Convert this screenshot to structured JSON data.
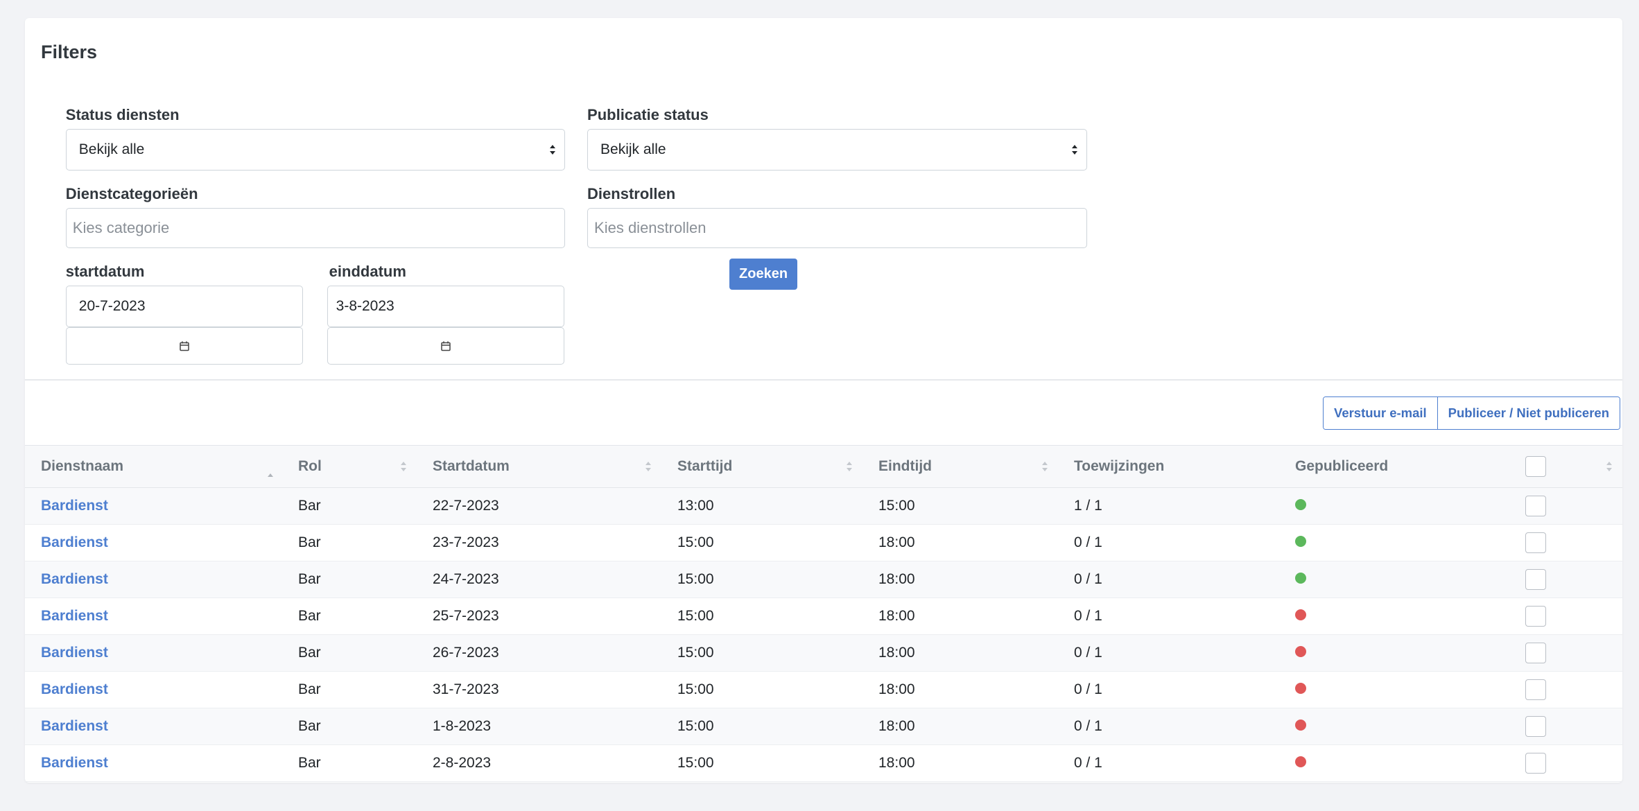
{
  "filters": {
    "title": "Filters",
    "status_diensten": {
      "label": "Status diensten",
      "value": "Bekijk alle"
    },
    "publicatie_status": {
      "label": "Publicatie status",
      "value": "Bekijk alle"
    },
    "dienstcategorieen": {
      "label": "Dienstcategorieën",
      "placeholder": "Kies categorie"
    },
    "dienstrollen": {
      "label": "Dienstrollen",
      "placeholder": "Kies dienstrollen"
    },
    "startdatum": {
      "label": "startdatum",
      "value": "20-7-2023"
    },
    "einddatum": {
      "label": "einddatum",
      "value": "3-8-2023"
    },
    "search_button": "Zoeken"
  },
  "actions": {
    "send_email": "Verstuur e-mail",
    "publish_toggle": "Publiceer / Niet publiceren"
  },
  "table": {
    "headers": [
      "Dienstnaam",
      "Rol",
      "Startdatum",
      "Starttijd",
      "Eindtijd",
      "Toewijzingen",
      "Gepubliceerd"
    ],
    "rows": [
      {
        "name": "Bardienst",
        "rol": "Bar",
        "startdatum": "22-7-2023",
        "starttijd": "13:00",
        "eindtijd": "15:00",
        "toewijzingen": "1 / 1",
        "gepubliceerd": true
      },
      {
        "name": "Bardienst",
        "rol": "Bar",
        "startdatum": "23-7-2023",
        "starttijd": "15:00",
        "eindtijd": "18:00",
        "toewijzingen": "0 / 1",
        "gepubliceerd": true
      },
      {
        "name": "Bardienst",
        "rol": "Bar",
        "startdatum": "24-7-2023",
        "starttijd": "15:00",
        "eindtijd": "18:00",
        "toewijzingen": "0 / 1",
        "gepubliceerd": true
      },
      {
        "name": "Bardienst",
        "rol": "Bar",
        "startdatum": "25-7-2023",
        "starttijd": "15:00",
        "eindtijd": "18:00",
        "toewijzingen": "0 / 1",
        "gepubliceerd": false
      },
      {
        "name": "Bardienst",
        "rol": "Bar",
        "startdatum": "26-7-2023",
        "starttijd": "15:00",
        "eindtijd": "18:00",
        "toewijzingen": "0 / 1",
        "gepubliceerd": false
      },
      {
        "name": "Bardienst",
        "rol": "Bar",
        "startdatum": "31-7-2023",
        "starttijd": "15:00",
        "eindtijd": "18:00",
        "toewijzingen": "0 / 1",
        "gepubliceerd": false
      },
      {
        "name": "Bardienst",
        "rol": "Bar",
        "startdatum": "1-8-2023",
        "starttijd": "15:00",
        "eindtijd": "18:00",
        "toewijzingen": "0 / 1",
        "gepubliceerd": false
      },
      {
        "name": "Bardienst",
        "rol": "Bar",
        "startdatum": "2-8-2023",
        "starttijd": "15:00",
        "eindtijd": "18:00",
        "toewijzingen": "0 / 1",
        "gepubliceerd": false
      }
    ]
  },
  "colors": {
    "accent": "#4e7fd0",
    "published": "#5cb85c",
    "unpublished": "#e05757"
  },
  "icons": {
    "date_picker": "calendar-icon",
    "select": "select-arrows-icon",
    "sort": "sort-icon"
  }
}
